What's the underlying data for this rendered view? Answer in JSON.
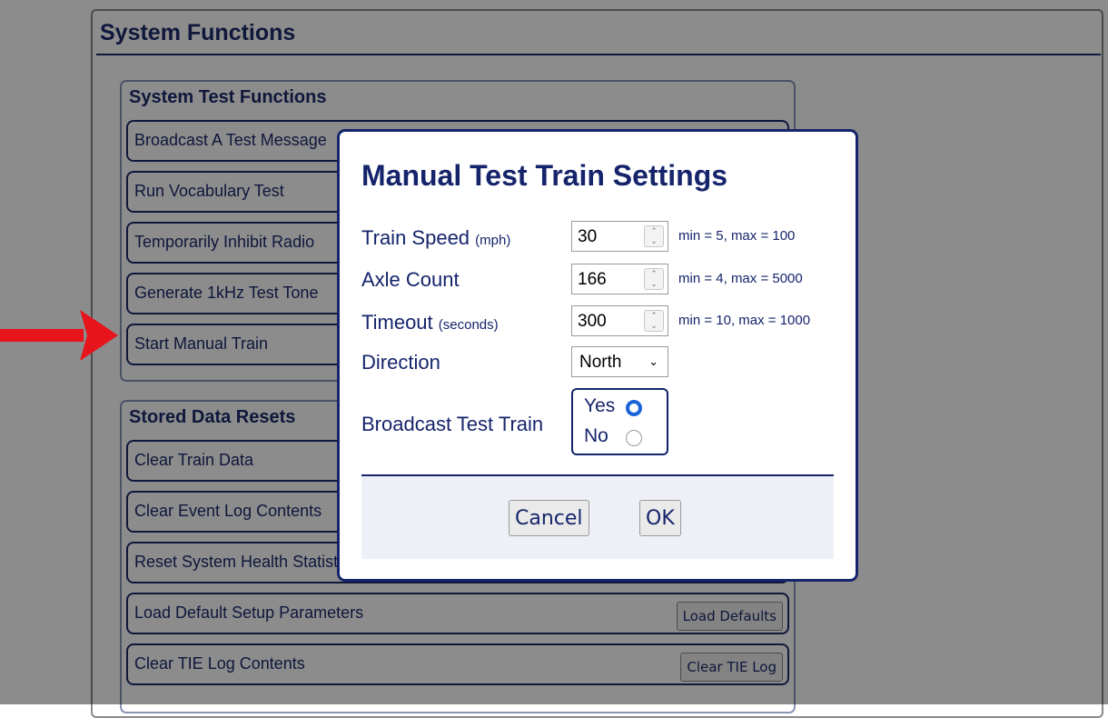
{
  "page": {
    "title": "System Functions",
    "test_group": {
      "title": "System Test Functions",
      "rows": [
        {
          "label": "Broadcast A Test Message"
        },
        {
          "label": "Run Vocabulary Test"
        },
        {
          "label": "Temporarily Inhibit Radio"
        },
        {
          "label": "Generate 1kHz Test Tone"
        },
        {
          "label": "Start Manual Train"
        }
      ]
    },
    "reset_group": {
      "title": "Stored Data Resets",
      "rows": [
        {
          "label": "Clear Train Data"
        },
        {
          "label": "Clear Event Log Contents"
        },
        {
          "label": "Reset System Health Statistics"
        },
        {
          "label": "Load Default Setup Parameters",
          "button": "Load Defaults"
        },
        {
          "label": "Clear TIE Log Contents",
          "button": "Clear TIE Log"
        }
      ]
    }
  },
  "modal": {
    "title": "Manual Test Train Settings",
    "fields": {
      "speed": {
        "label": "Train Speed",
        "unit": "(mph)",
        "value": "30",
        "hint": "min = 5, max = 100"
      },
      "axles": {
        "label": "Axle Count",
        "unit": "",
        "value": "166",
        "hint": "min = 4, max = 5000"
      },
      "timeout": {
        "label": "Timeout",
        "unit": "(seconds)",
        "value": "300",
        "hint": "min = 10, max = 1000"
      },
      "direction": {
        "label": "Direction",
        "value": "North"
      },
      "broadcast": {
        "label": "Broadcast Test Train",
        "yes": "Yes",
        "no": "No",
        "selected": "Yes"
      }
    },
    "buttons": {
      "cancel": "Cancel",
      "ok": "OK"
    }
  },
  "colors": {
    "accent": "#15246b",
    "radio": "#1b64d8",
    "arrow": "#e8141b"
  }
}
